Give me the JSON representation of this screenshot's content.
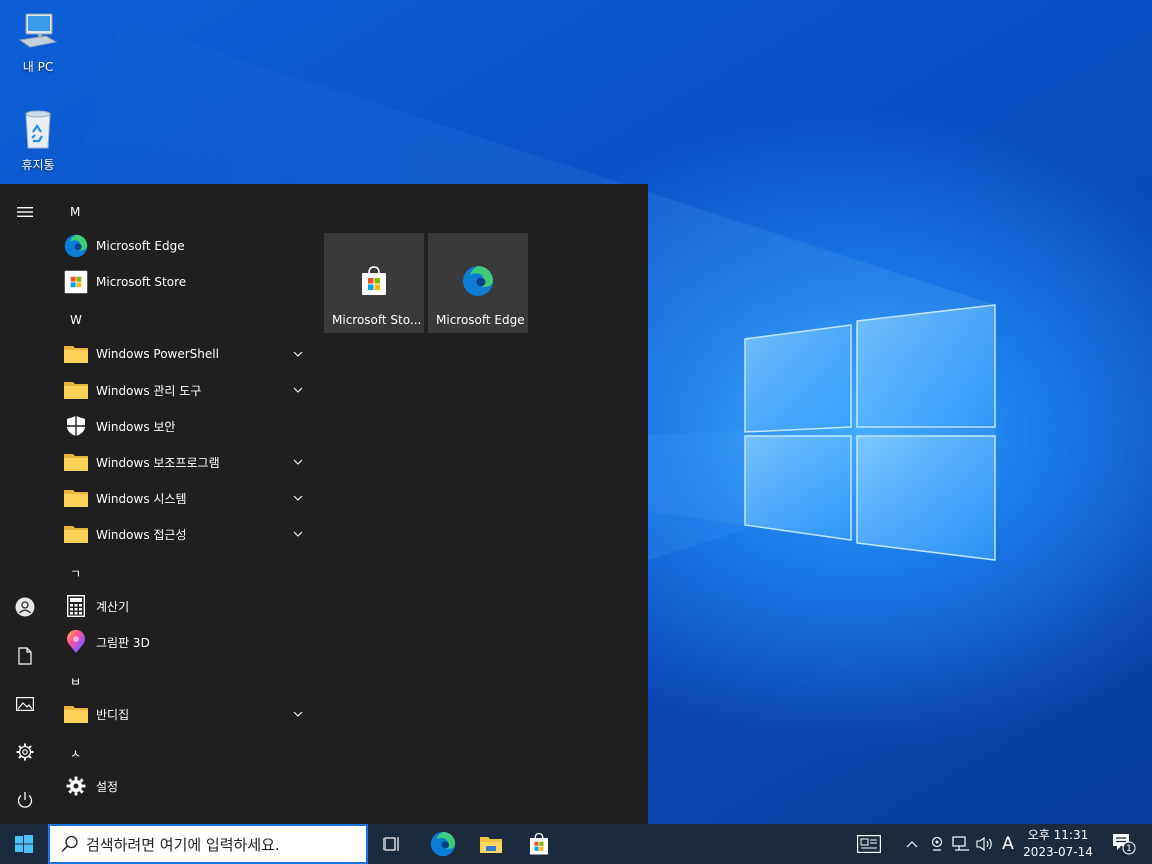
{
  "desktop": {
    "icons": [
      {
        "label": "내 PC",
        "icon": "computer-icon"
      },
      {
        "label": "휴지통",
        "icon": "recycle-bin-icon"
      }
    ]
  },
  "start_menu": {
    "rail": [
      "hamburger-menu-icon",
      "user-icon",
      "documents-icon",
      "pictures-icon",
      "settings-icon",
      "power-icon"
    ],
    "apps": [
      {
        "kind": "header",
        "label": "M"
      },
      {
        "kind": "app",
        "label": "Microsoft Edge",
        "icon": "edge-icon"
      },
      {
        "kind": "app",
        "label": "Microsoft Store",
        "icon": "store-icon"
      },
      {
        "kind": "header",
        "label": "W"
      },
      {
        "kind": "folder",
        "label": "Windows PowerShell",
        "icon": "folder-icon",
        "expandable": true
      },
      {
        "kind": "folder",
        "label": "Windows 관리 도구",
        "icon": "folder-icon",
        "expandable": true
      },
      {
        "kind": "app",
        "label": "Windows 보안",
        "icon": "shield-icon"
      },
      {
        "kind": "folder",
        "label": "Windows 보조프로그램",
        "icon": "folder-icon",
        "expandable": true
      },
      {
        "kind": "folder",
        "label": "Windows 시스템",
        "icon": "folder-icon",
        "expandable": true
      },
      {
        "kind": "folder",
        "label": "Windows 접근성",
        "icon": "folder-icon",
        "expandable": true
      },
      {
        "kind": "header",
        "label": "ㄱ"
      },
      {
        "kind": "app",
        "label": "계산기",
        "icon": "calculator-icon"
      },
      {
        "kind": "app",
        "label": "그림판 3D",
        "icon": "paint3d-icon"
      },
      {
        "kind": "header",
        "label": "ㅂ"
      },
      {
        "kind": "folder",
        "label": "반디집",
        "icon": "folder-icon",
        "expandable": true
      },
      {
        "kind": "header",
        "label": "ㅅ"
      },
      {
        "kind": "app",
        "label": "설정",
        "icon": "gear-icon"
      }
    ],
    "tiles": [
      {
        "label": "Microsoft Sto...",
        "icon": "store-icon"
      },
      {
        "label": "Microsoft Edge",
        "icon": "edge-icon"
      }
    ]
  },
  "taskbar": {
    "search_placeholder": "검색하려면 여기에 입력하세요.",
    "pinned": [
      "task-view-icon",
      "edge-icon",
      "file-explorer-icon",
      "store-icon"
    ],
    "tray": {
      "ime": "A",
      "time": "오후 11:31",
      "date": "2023-07-14",
      "notification_count": "1"
    }
  },
  "colors": {
    "start_bg": "#1f1f1f",
    "tile_bg": "#3a3a3a",
    "taskbar_bg": "#1c2a3e",
    "accent": "#1a73e8"
  }
}
